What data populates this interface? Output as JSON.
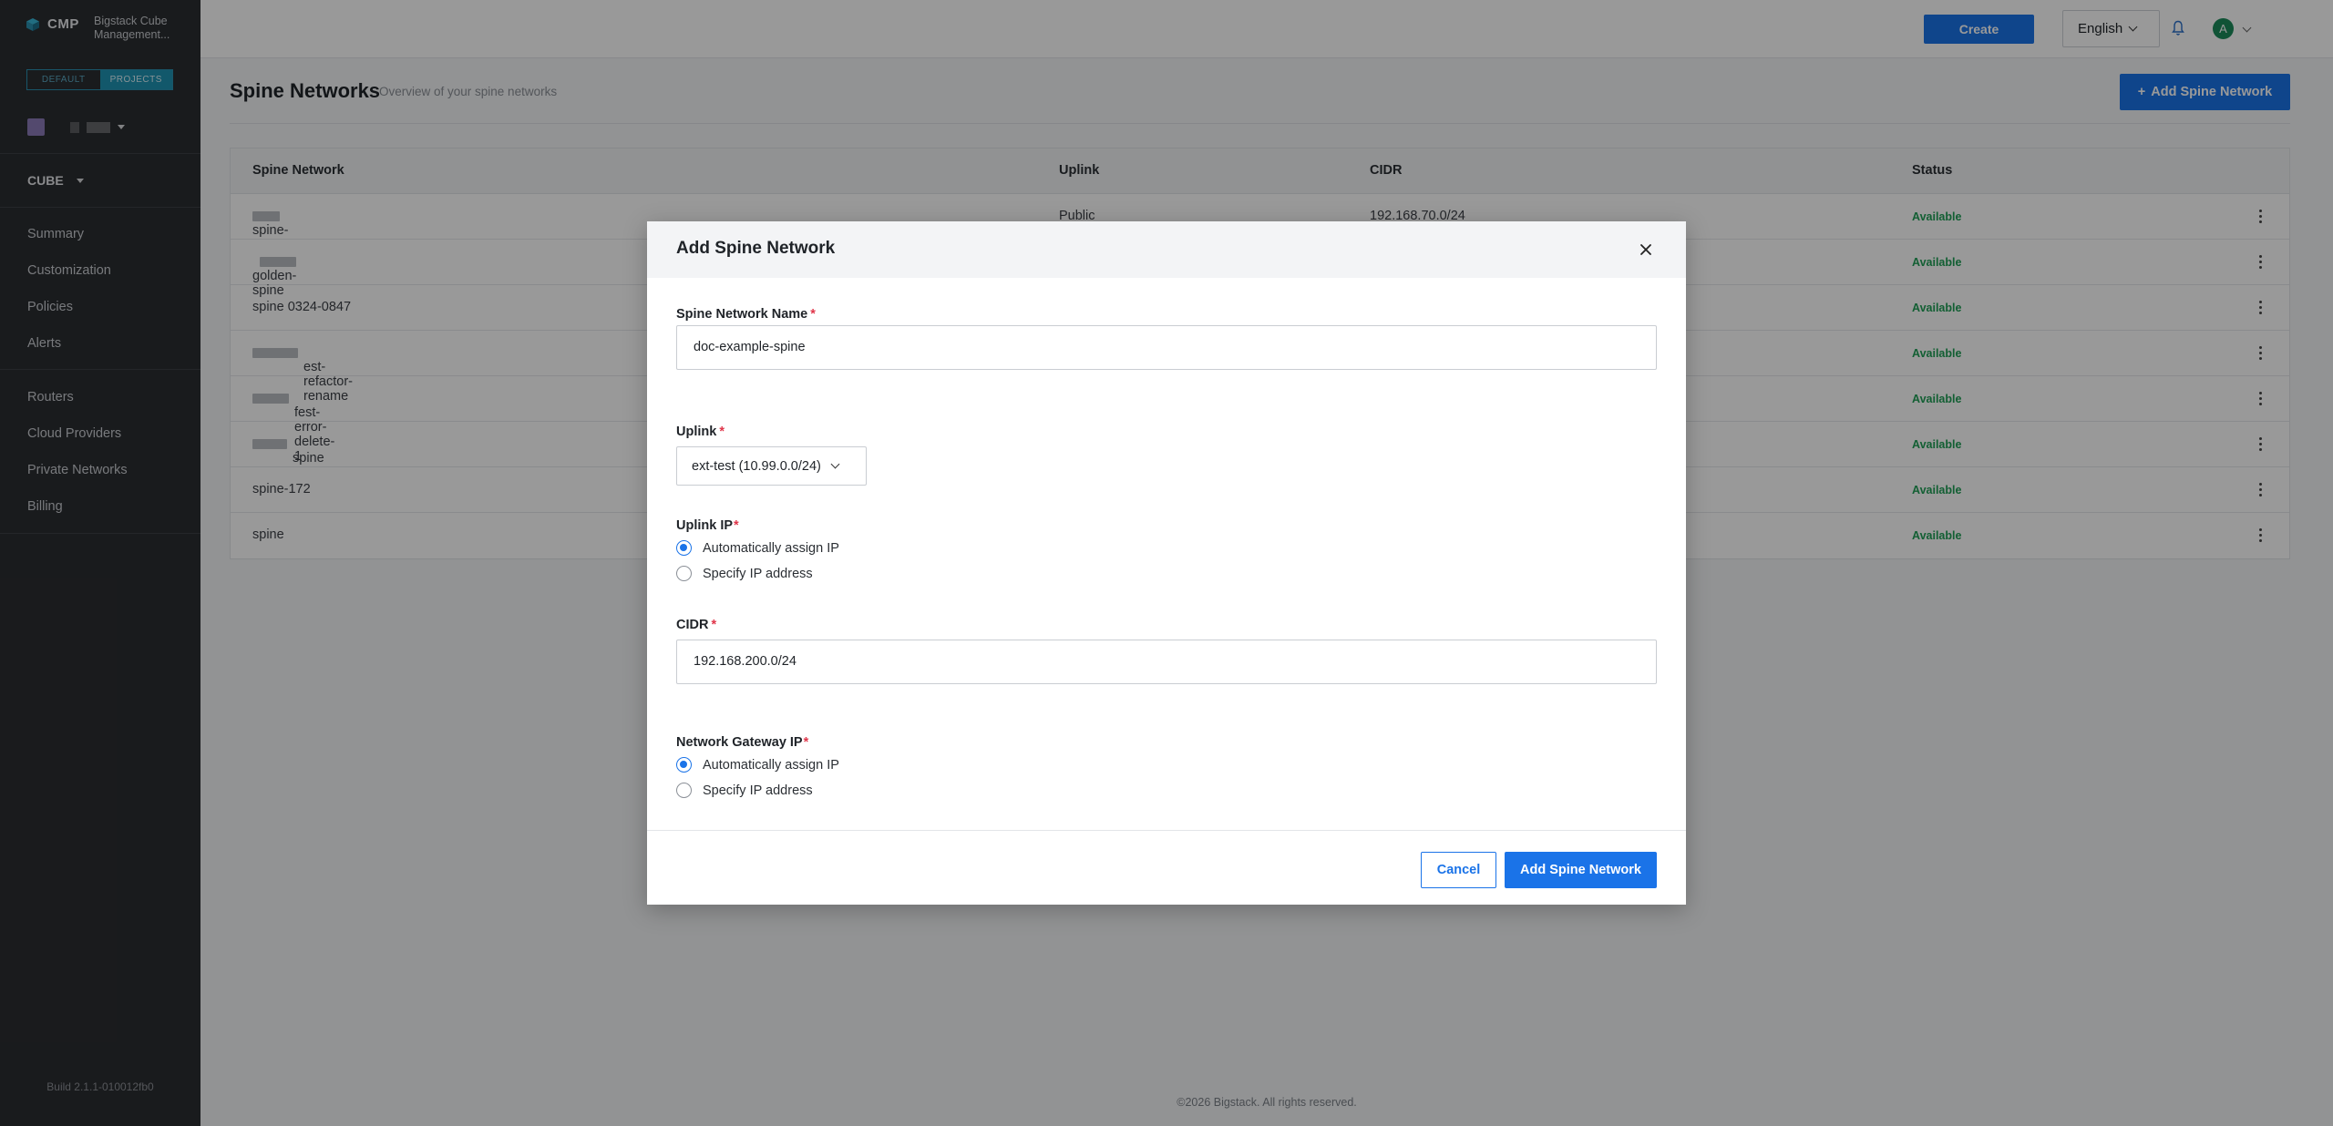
{
  "app": {
    "logo_text": "CMP",
    "subtitle": "Bigstack Cube Management...",
    "scope": {
      "default_label": "DEFAULT",
      "projects_label": "PROJECTS"
    },
    "cube_label": "CUBE",
    "build": "Build 2.1.1-010012fb0"
  },
  "sidebar": {
    "items": [
      {
        "label": "Summary"
      },
      {
        "label": "Customization"
      },
      {
        "label": "Policies"
      },
      {
        "label": "Alerts"
      },
      {
        "label": "Routers"
      },
      {
        "label": "Cloud Providers"
      },
      {
        "label": "Private Networks"
      },
      {
        "label": "Billing"
      }
    ]
  },
  "header": {
    "create_label": "Create",
    "language": "English",
    "avatar_initial": "A"
  },
  "page": {
    "title": "Spine Networks",
    "subtitle": "Overview of your spine networks",
    "add_button": "Add Spine Network"
  },
  "table": {
    "columns": [
      "Spine Network",
      "Uplink",
      "CIDR",
      "Status"
    ],
    "rows": [
      {
        "name": "spine-",
        "uplink": "Public",
        "cidr": "192.168.70.0/24",
        "status": "Available"
      },
      {
        "name": "golden-spine",
        "uplink": "",
        "cidr": "",
        "status": "Available"
      },
      {
        "name": "spine 0324-0847",
        "uplink": "",
        "cidr": "",
        "status": "Available"
      },
      {
        "name": "est-refactor-rename",
        "uplink": "",
        "cidr": "",
        "status": "Available"
      },
      {
        "name": "fest-error-delete-1",
        "uplink": "",
        "cidr": "",
        "status": "Available"
      },
      {
        "name": "spine",
        "uplink": "",
        "cidr": "",
        "status": "Available"
      },
      {
        "name": "spine-172",
        "uplink": "",
        "cidr": "",
        "status": "Available"
      },
      {
        "name": "spine",
        "uplink": "",
        "cidr": "",
        "status": "Available"
      }
    ]
  },
  "footer": "©2026 Bigstack. All rights reserved.",
  "modal": {
    "title": "Add Spine Network",
    "name_label": "Spine Network Name",
    "name_value": "doc-example-spine",
    "uplink_label": "Uplink",
    "uplink_value": "ext-test (10.99.0.0/24)",
    "uplink_ip_label": "Uplink IP",
    "uplink_ip_options": [
      "Automatically assign IP",
      "Specify IP address"
    ],
    "cidr_label": "CIDR",
    "cidr_value": "192.168.200.0/24",
    "gateway_label": "Network Gateway IP",
    "gateway_options": [
      "Automatically assign IP",
      "Specify IP address"
    ],
    "required_mark": "*",
    "cancel_label": "Cancel",
    "submit_label": "Add Spine Network"
  },
  "colors": {
    "primary": "#1a73e8",
    "sidebar_bg": "#2b2d31",
    "status_available": "#1e9e55",
    "required": "#e0364a"
  }
}
